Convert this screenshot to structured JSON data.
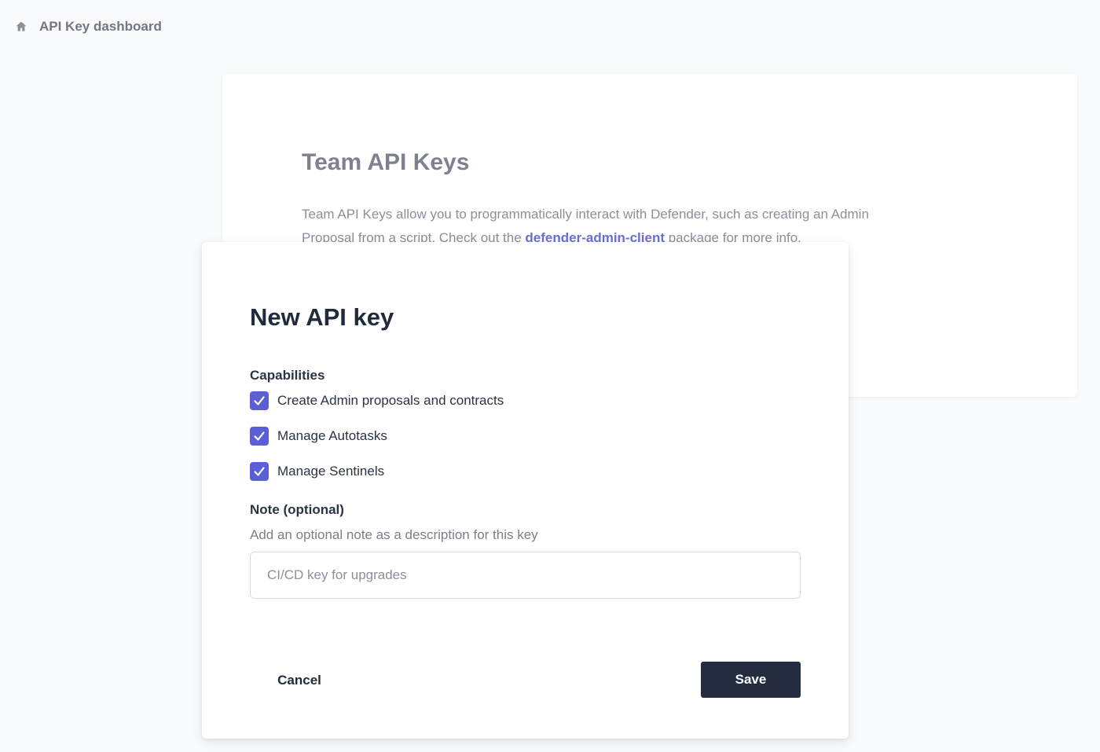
{
  "header": {
    "icon": "home-icon",
    "title": "API Key dashboard"
  },
  "background_card": {
    "title": "Team API Keys",
    "description_before_link": "Team API Keys allow you to programmatically interact with Defender, such as creating an Admin Proposal from a script. Check out the ",
    "link_text": "defender-admin-client",
    "description_after_link": " package for more info."
  },
  "modal": {
    "title": "New API key",
    "capabilities_label": "Capabilities",
    "capabilities": [
      {
        "label": "Create Admin proposals and contracts",
        "checked": true
      },
      {
        "label": "Manage Autotasks",
        "checked": true
      },
      {
        "label": "Manage Sentinels",
        "checked": true
      }
    ],
    "note_label": "Note (optional)",
    "note_help": "Add an optional note as a description for this key",
    "note_input": {
      "placeholder": "CI/CD key for upgrades",
      "value": ""
    },
    "cancel_label": "Cancel",
    "save_label": "Save"
  },
  "colors": {
    "accent": "#5b5fd6",
    "primary_button": "#232d3f",
    "link": "#6b6fd3"
  }
}
